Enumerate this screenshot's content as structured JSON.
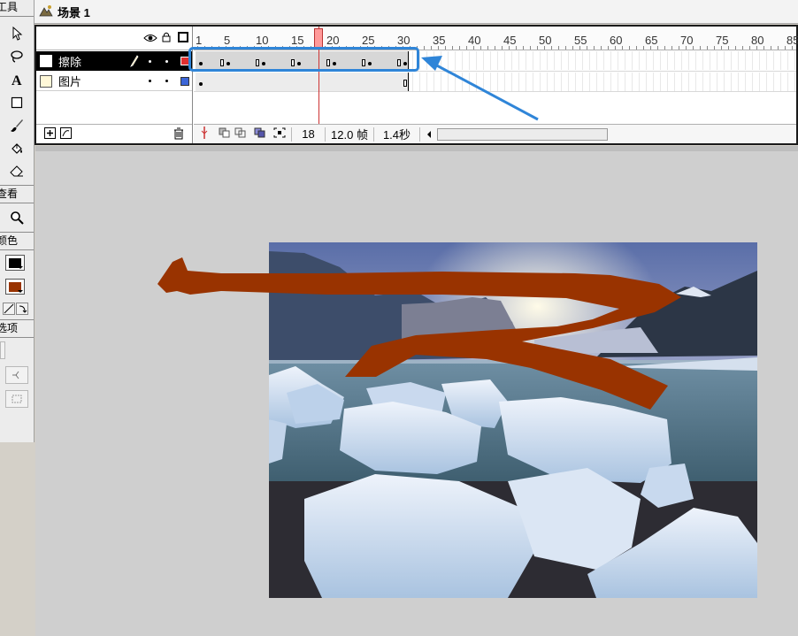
{
  "tools": {
    "panel_title": "工具",
    "view_title": "查看",
    "colors_title": "颜色",
    "options_title": "选项",
    "stroke_color": "#000000",
    "fill_color": "#993300"
  },
  "scene": {
    "label": "场景 1"
  },
  "timeline": {
    "frame_numbers": [
      "1",
      "5",
      "10",
      "15",
      "20",
      "25",
      "30",
      "35",
      "40",
      "45",
      "50",
      "55",
      "60",
      "65",
      "70",
      "75",
      "80",
      "85"
    ],
    "current_frame": "18",
    "frame_rate": "12.0 帧",
    "elapsed_time": "1.4秒",
    "layers": [
      {
        "name": "擦除",
        "selected": true,
        "layer_color": "#e03030"
      },
      {
        "name": "图片",
        "selected": false,
        "layer_color": "#3c66d8"
      }
    ]
  },
  "colors": {
    "annotation_blue": "#2f85d8",
    "brush_stroke": "#993300"
  }
}
